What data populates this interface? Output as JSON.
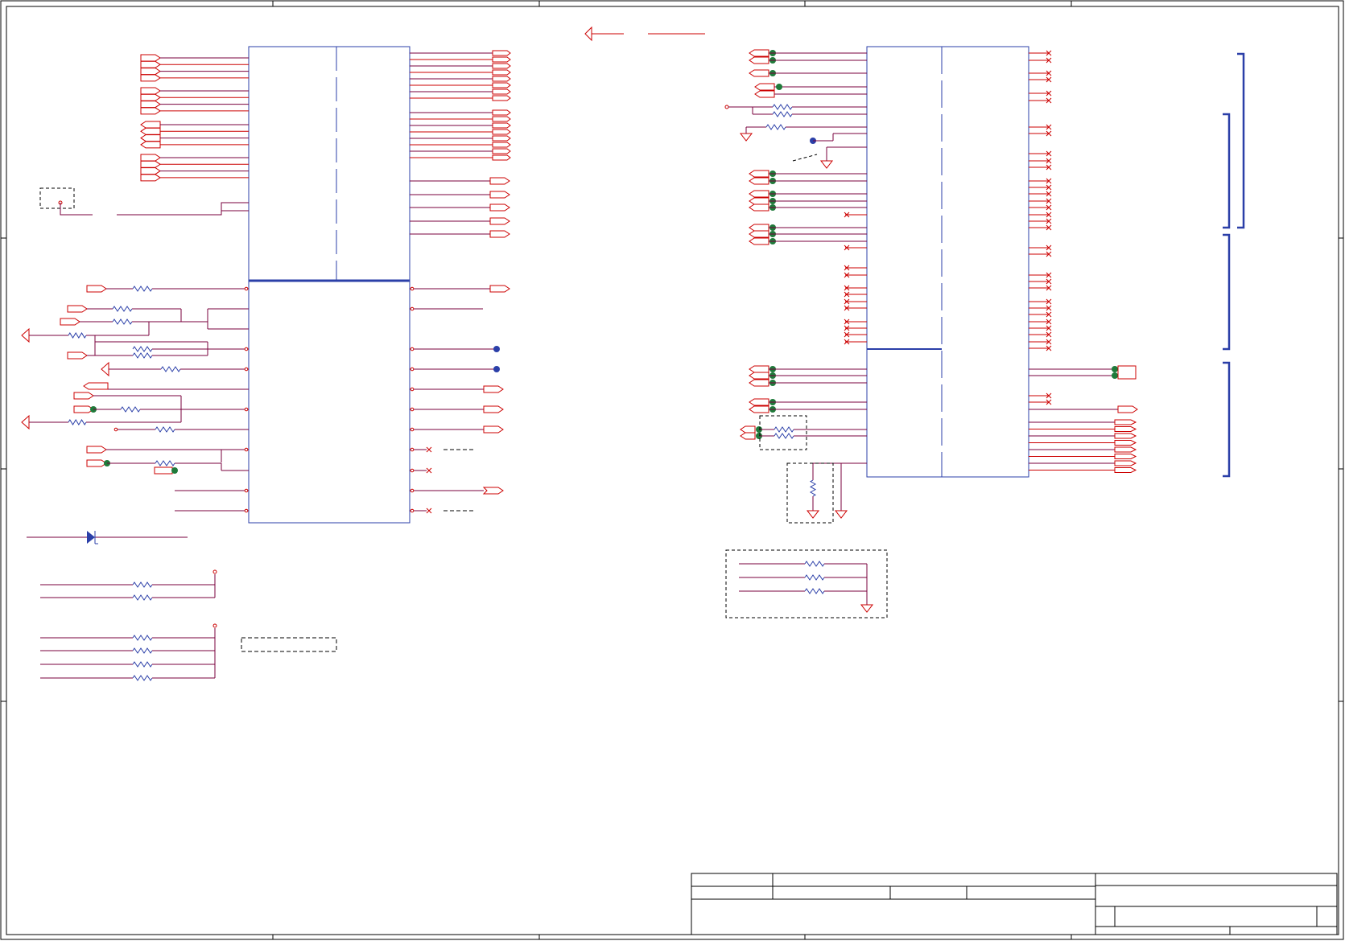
{
  "sheet": {
    "title": "",
    "colors": {
      "frame": "#000000",
      "wire": "#cc0000",
      "net": "#7a003c",
      "part": "#2b3fa8",
      "junction_green": "#1f7a3a",
      "junction_blue": "#2b4aa8"
    }
  },
  "symbols": {
    "resistor": "resistor-icon",
    "ground": "ground-arrow-icon",
    "port": "port-flag-icon",
    "no_connect": "no-connect-x-icon",
    "diode": "diode-icon",
    "bracket": "bracket-icon"
  },
  "title_block": {
    "row1_left": "",
    "row1_right": "",
    "row2_a": "",
    "row2_b": "",
    "row2_c": "",
    "row2_d": "",
    "sheet_label": "",
    "sheet_number": ""
  }
}
